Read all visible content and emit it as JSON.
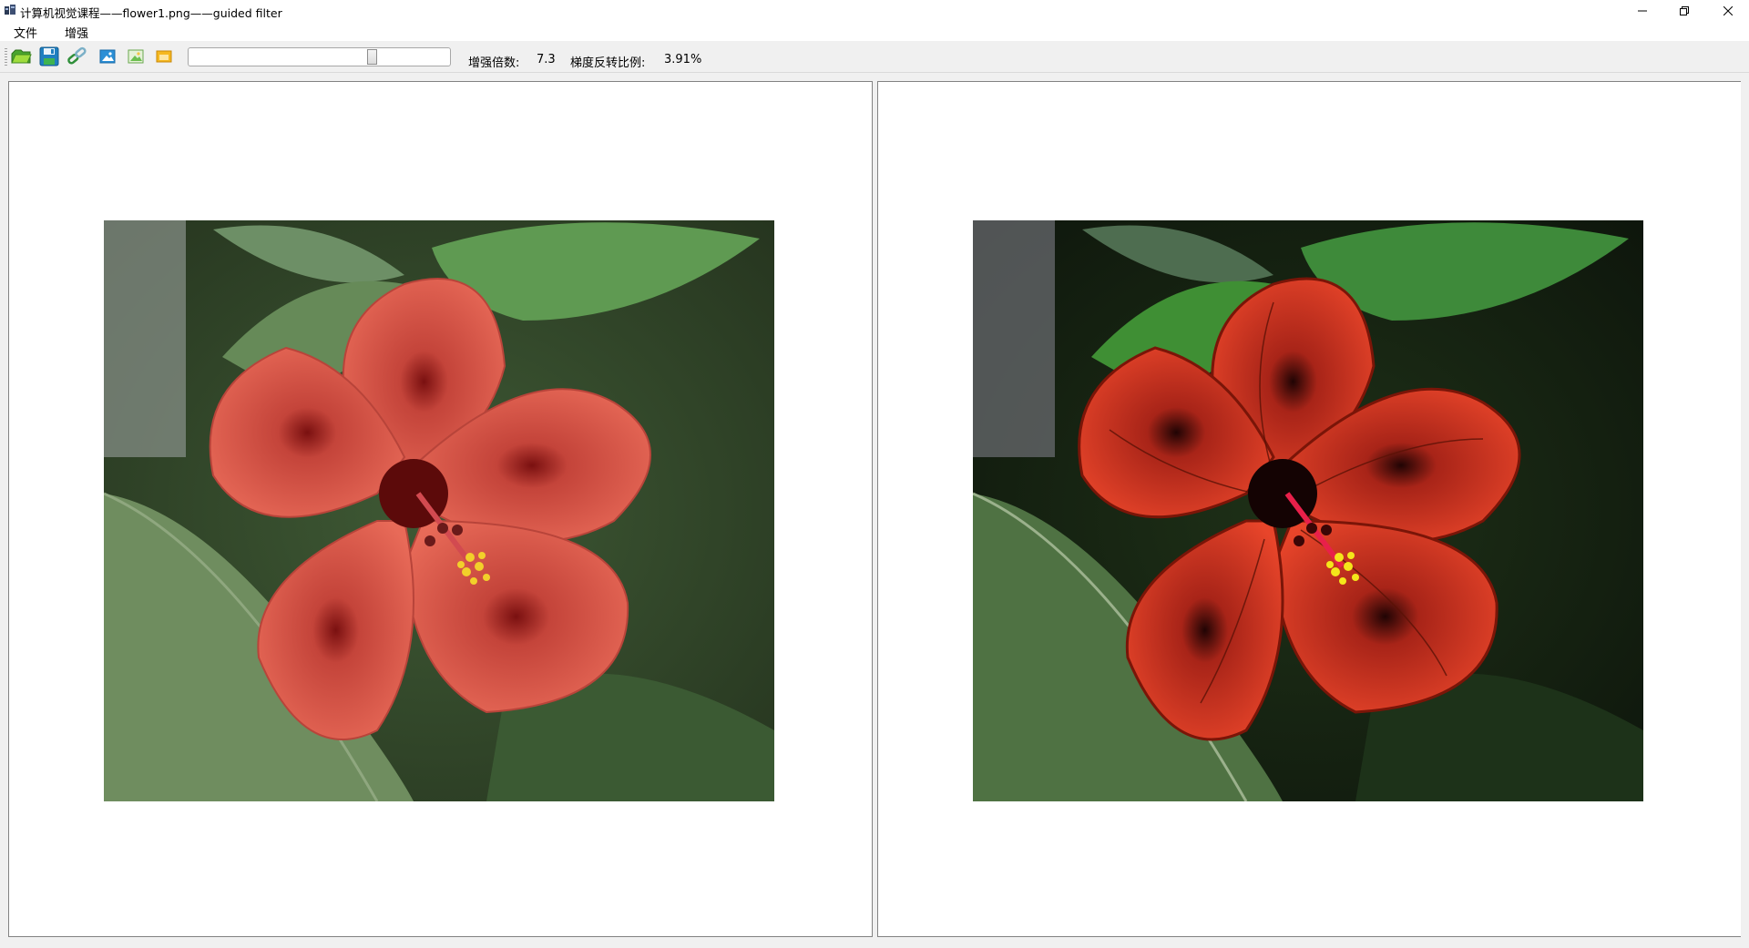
{
  "window": {
    "title": "计算机视觉课程——flower1.png——guided filter",
    "controls": [
      "minimize-icon",
      "restore-icon",
      "close-icon"
    ]
  },
  "menu": {
    "items": [
      {
        "label": "文件"
      },
      {
        "label": "增强"
      }
    ]
  },
  "toolbar": {
    "buttons": [
      {
        "icon": "open-icon"
      },
      {
        "icon": "save-icon"
      },
      {
        "icon": "link-icon"
      },
      {
        "icon": "image-icon"
      },
      {
        "icon": "picture-icon"
      },
      {
        "icon": "folder-image-icon"
      }
    ],
    "slider": {
      "level_percent": 71
    },
    "status": {
      "gain_label": "增强倍数:",
      "gain_value": "7.3",
      "gradient_label": "梯度反转比例:",
      "gradient_value": "3.91%"
    }
  },
  "panels": {
    "left": {
      "image": "original hibiscus flower photo"
    },
    "right": {
      "image": "enhanced hibiscus flower photo"
    }
  },
  "colors": {
    "petal": "#e0584a",
    "petal_enhanced": "#d83a25",
    "leaf": "#5d8a4e",
    "stamen": "#f2d02a"
  }
}
